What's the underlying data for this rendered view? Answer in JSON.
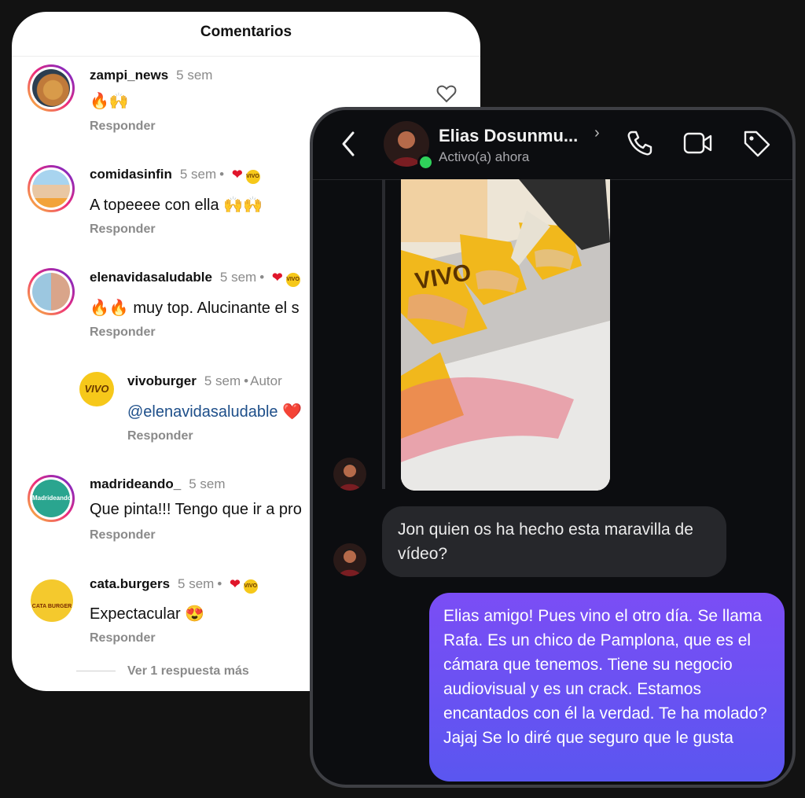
{
  "comments_panel": {
    "title": "Comentarios",
    "items": [
      {
        "username": "zampi_news",
        "ago": "5 sem",
        "text": "🔥🙌",
        "reply": "Responder"
      },
      {
        "username": "comidasinfin",
        "ago": "5 sem",
        "text": "A topeeee con ella 🙌🙌",
        "reply": "Responder"
      },
      {
        "username": "elenavidasaludable",
        "ago": "5 sem",
        "text": "🔥🔥 muy top. Alucinante el s",
        "reply": "Responder"
      },
      {
        "username": "vivoburger",
        "ago": "5 sem",
        "author": "Autor",
        "text": "@elenavidasaludable ❤️",
        "reply": "Responder"
      },
      {
        "username": "madrideando_",
        "ago": "5 sem",
        "text": "Que pinta!!! Tengo que ir a pro",
        "reply": "Responder"
      },
      {
        "username": "cata.burgers",
        "ago": "5 sem",
        "text": "Expectacular 😍",
        "reply": "Responder"
      }
    ],
    "more_replies": "Ver 1 respuesta más",
    "avatar_labels": {
      "vivo": "VIVO",
      "madrideando": "Madrideando",
      "cata": "CATA BURGER"
    }
  },
  "dm_panel": {
    "contact_name": "Elias Dosunmu...",
    "status": "Activo(a) ahora",
    "messages": [
      {
        "from": "contact",
        "type": "video"
      },
      {
        "from": "contact",
        "text": "Jon quien os ha hecho esta maravilla de vídeo?"
      },
      {
        "from": "me",
        "text": "Elias amigo! Pues vino el otro día. Se llama Rafa. Es un chico de Pamplona, que es el  cámara que tenemos. Tiene su negocio audiovisual y es un crack. Estamos encantados con él la verdad. Te ha molado? Jajaj Se lo diré que seguro que le gusta"
      }
    ],
    "video_label": "VIVO"
  },
  "colors": {
    "background": "#121212",
    "story_ring": "#ee2a7b",
    "online": "#2fd15a",
    "outgoing_bubble": "#6a52f2",
    "incoming_bubble": "#26272b",
    "like": "#e0162b"
  }
}
